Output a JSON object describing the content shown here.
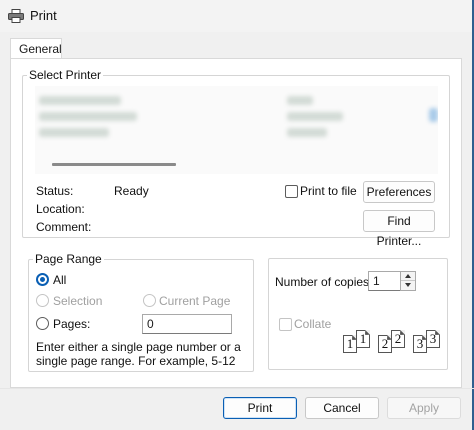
{
  "window": {
    "title": "Print"
  },
  "tabs": [
    {
      "label": "General"
    }
  ],
  "select_printer": {
    "legend": "Select Printer",
    "status_label": "Status:",
    "status_value": "Ready",
    "location_label": "Location:",
    "location_value": "",
    "comment_label": "Comment:",
    "comment_value": "",
    "print_to_file_label": "Print to file",
    "print_to_file_checked": false,
    "preferences_label": "Preferences",
    "find_printer_label": "Find Printer..."
  },
  "page_range": {
    "legend": "Page Range",
    "all_label": "All",
    "selection_label": "Selection",
    "current_page_label": "Current Page",
    "pages_label": "Pages:",
    "pages_value": "0",
    "selected": "All",
    "hint": "Enter either a single page number or a single page range.  For example, 5-12"
  },
  "copies": {
    "label": "Number of copies:",
    "value": "1",
    "collate_label": "Collate",
    "collate_checked": false,
    "collate_pages": [
      "1",
      "1",
      "2",
      "2",
      "3",
      "3"
    ]
  },
  "footer": {
    "print_label": "Print",
    "cancel_label": "Cancel",
    "apply_label": "Apply"
  },
  "colors": {
    "accent": "#0a5fb4",
    "window_bg": "#f0f0f0",
    "panel_bg": "#ffffff",
    "disabled_text": "#a0a0a0"
  },
  "icons": [
    "printer-icon",
    "spin-up-icon",
    "spin-down-icon",
    "collate-pages-icon"
  ]
}
